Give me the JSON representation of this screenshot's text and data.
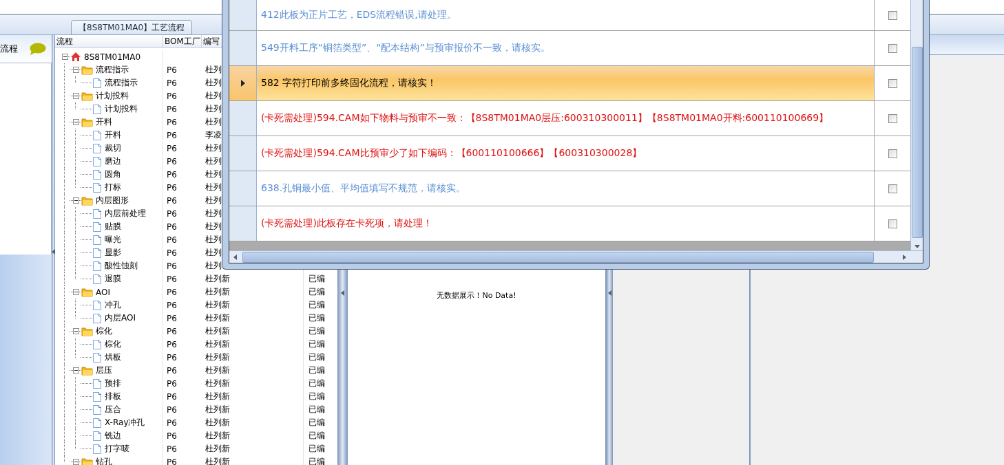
{
  "app_tab": {
    "label": "【8S8TM01MA0】工艺流程"
  },
  "left_panel": {
    "title": "流程"
  },
  "tree_grid": {
    "columns": [
      "流程",
      "BOM工厂",
      "编写"
    ],
    "tree": {
      "label": "8S8TM01MA0",
      "kind": "root",
      "expanded": true,
      "children": [
        {
          "label": "流程指示",
          "kind": "group",
          "plant": "P6",
          "author": "杜列",
          "expanded": true,
          "children": [
            {
              "label": "流程指示",
              "kind": "step",
              "plant": "P6",
              "author": "杜列"
            }
          ]
        },
        {
          "label": "计划投料",
          "kind": "group",
          "plant": "P6",
          "author": "杜列",
          "expanded": true,
          "children": [
            {
              "label": "计划投料",
              "kind": "step",
              "plant": "P6",
              "author": "杜列"
            }
          ]
        },
        {
          "label": "开料",
          "kind": "group",
          "plant": "P6",
          "author": "杜列",
          "expanded": true,
          "children": [
            {
              "label": "开料",
              "kind": "step",
              "plant": "P6",
              "author": "李凌"
            },
            {
              "label": "裁切",
              "kind": "step",
              "plant": "P6",
              "author": "杜列"
            },
            {
              "label": "磨边",
              "kind": "step",
              "plant": "P6",
              "author": "杜列"
            },
            {
              "label": "圆角",
              "kind": "step",
              "plant": "P6",
              "author": "杜列"
            },
            {
              "label": "打标",
              "kind": "step",
              "plant": "P6",
              "author": "杜列"
            }
          ]
        },
        {
          "label": "内层图形",
          "kind": "group",
          "plant": "P6",
          "author": "杜列",
          "expanded": true,
          "children": [
            {
              "label": "内层前处理",
              "kind": "step",
              "plant": "P6",
              "author": "杜列"
            },
            {
              "label": "贴膜",
              "kind": "step",
              "plant": "P6",
              "author": "杜列"
            },
            {
              "label": "曝光",
              "kind": "step",
              "plant": "P6",
              "author": "杜列"
            },
            {
              "label": "显影",
              "kind": "step",
              "plant": "P6",
              "author": "杜列"
            },
            {
              "label": "酸性蚀刻",
              "kind": "step",
              "plant": "P6",
              "author": "杜列"
            },
            {
              "label": "退膜",
              "kind": "step",
              "plant": "P6",
              "author": "杜列新",
              "status": "已编"
            }
          ]
        },
        {
          "label": "AOI",
          "kind": "group",
          "plant": "P6",
          "author": "杜列新",
          "status": "已编",
          "expanded": true,
          "children": [
            {
              "label": "冲孔",
              "kind": "step",
              "plant": "P6",
              "author": "杜列新",
              "status": "已编"
            },
            {
              "label": "内层AOI",
              "kind": "step",
              "plant": "P6",
              "author": "杜列新",
              "status": "已编"
            }
          ]
        },
        {
          "label": "棕化",
          "kind": "group",
          "plant": "P6",
          "author": "杜列新",
          "status": "已编",
          "expanded": true,
          "children": [
            {
              "label": "棕化",
              "kind": "step",
              "plant": "P6",
              "author": "杜列新",
              "status": "已编"
            },
            {
              "label": "烘板",
              "kind": "step",
              "plant": "P6",
              "author": "杜列新",
              "status": "已编"
            }
          ]
        },
        {
          "label": "层压",
          "kind": "group",
          "plant": "P6",
          "author": "杜列新",
          "status": "已编",
          "expanded": true,
          "children": [
            {
              "label": "预排",
              "kind": "step",
              "plant": "P6",
              "author": "杜列新",
              "status": "已编"
            },
            {
              "label": "排板",
              "kind": "step",
              "plant": "P6",
              "author": "杜列新",
              "status": "已编"
            },
            {
              "label": "压合",
              "kind": "step",
              "plant": "P6",
              "author": "杜列新",
              "status": "已编"
            },
            {
              "label": "X-Ray冲孔",
              "kind": "step",
              "plant": "P6",
              "author": "杜列新",
              "status": "已编"
            },
            {
              "label": "铣边",
              "kind": "step",
              "plant": "P6",
              "author": "杜列新",
              "status": "已编"
            },
            {
              "label": "打字唛",
              "kind": "step",
              "plant": "P6",
              "author": "杜列新",
              "status": "已编"
            }
          ]
        },
        {
          "label": "钻孔",
          "kind": "group",
          "plant": "P6",
          "author": "杜列新",
          "status": "已编",
          "expanded": true
        }
      ]
    }
  },
  "detail_panel": {
    "empty_message": "无数据展示！No Data!"
  },
  "popup": {
    "messages": [
      {
        "text": "412此板为正片工艺，EDS流程错误,请处理。",
        "kind": "notice",
        "selected": false,
        "checked": false
      },
      {
        "text": "549开料工序“铜箔类型”、“配本结构”与预审报价不一致，请核实。",
        "kind": "notice",
        "selected": false,
        "checked": false
      },
      {
        "text": "582 字符打印前多终固化流程，请核实！",
        "kind": "notice",
        "selected": true,
        "checked": false
      },
      {
        "text": "(卡死需处理)594.CAM如下物料与预审不一致：【8S8TM01MA0层压:600310300011】【8S8TM01MA0开料:600110100669】",
        "kind": "blocking",
        "selected": false,
        "checked": false
      },
      {
        "text": "(卡死需处理)594.CAM比预审少了如下编码：【600110100666】【600310300028】",
        "kind": "blocking",
        "selected": false,
        "checked": false
      },
      {
        "text": "638.孔铜最小值、平均值填写不规范，请核实。",
        "kind": "notice",
        "selected": false,
        "checked": false
      },
      {
        "text": "(卡死需处理)此板存在卡死项，请处理！",
        "kind": "blocking",
        "selected": false,
        "checked": false
      }
    ]
  }
}
